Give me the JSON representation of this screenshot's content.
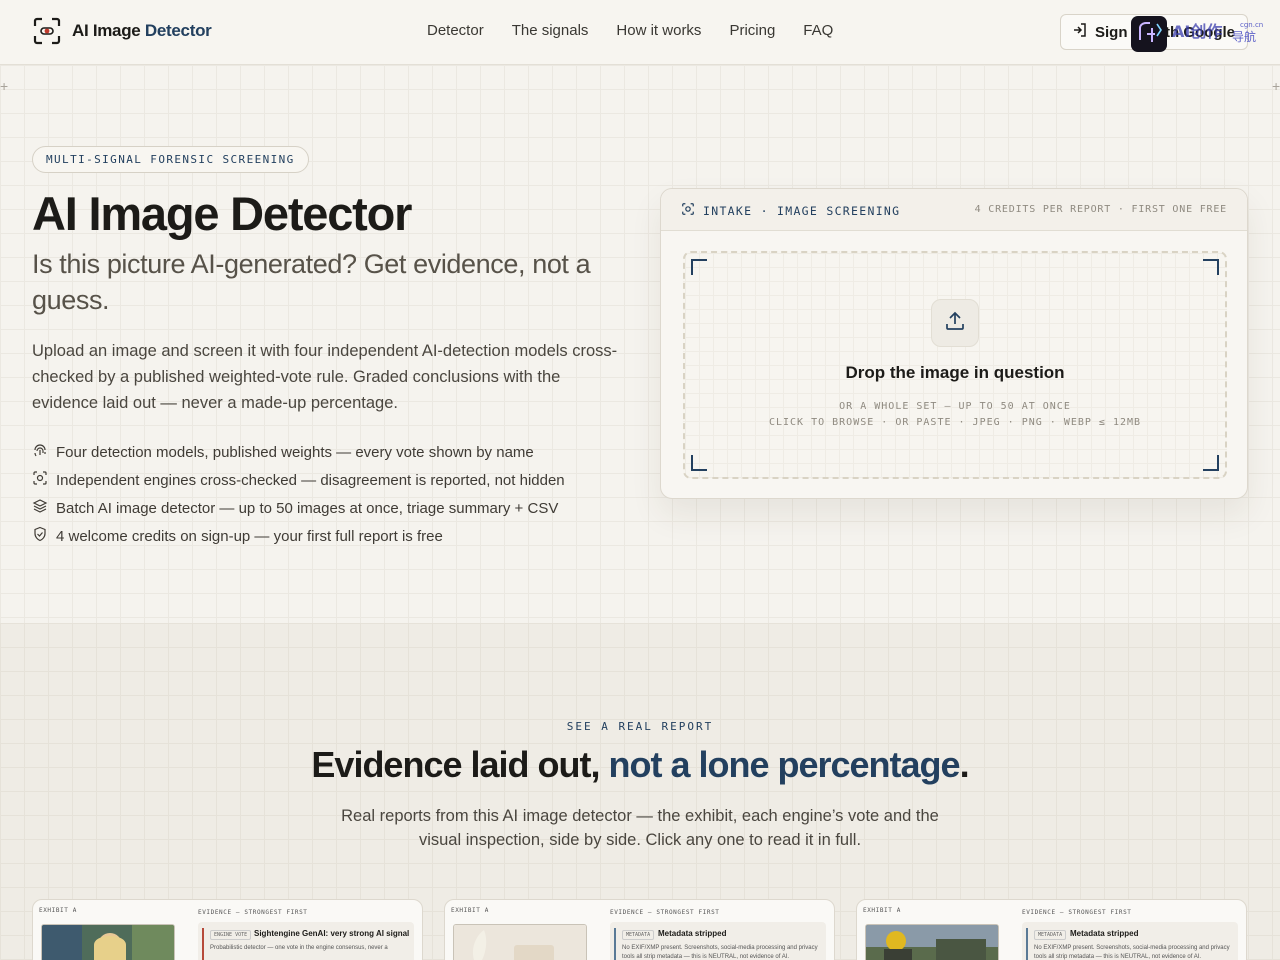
{
  "header": {
    "brand_prefix": "AI Image",
    "brand_accent": "Detector",
    "nav": [
      "Detector",
      "The signals",
      "How it works",
      "Pricing",
      "FAQ"
    ],
    "signin_label": "Sign in with Google"
  },
  "hero": {
    "pill": "MULTI-SIGNAL FORENSIC SCREENING",
    "title": "AI Image Detector",
    "subtitle": "Is this picture AI-generated? Get evidence, not a guess.",
    "lead": "Upload an image and screen it with four independent AI-detection models cross-checked by a published weighted-vote rule. Graded conclusions with the evidence laid out — never a made-up percentage.",
    "features": [
      {
        "icon": "fingerprint-icon",
        "text": "Four detection models, published weights — every vote shown by name"
      },
      {
        "icon": "scan-icon",
        "text": "Independent engines cross-checked — disagreement is reported, not hidden"
      },
      {
        "icon": "layers-icon",
        "text": "Batch AI image detector — up to 50 images at once, triage summary + CSV"
      },
      {
        "icon": "shield-check-icon",
        "text": "4 welcome credits on sign-up — your first full report is free"
      }
    ]
  },
  "intake": {
    "title": "INTAKE · IMAGE SCREENING",
    "meta": "4 CREDITS PER REPORT · FIRST ONE FREE",
    "drop_title": "Drop the image in question",
    "drop_sub_1": "OR A WHOLE SET — UP TO 50 AT ONCE",
    "drop_sub_2": "CLICK TO BROWSE · OR PASTE · JPEG · PNG · WEBP ≤ 12MB"
  },
  "reports_section": {
    "kicker": "SEE A REAL REPORT",
    "title_main": "Evidence laid out, ",
    "title_accent": "not a lone percentage",
    "title_end": ".",
    "subtitle": "Real reports from this AI image detector — the exhibit, each engine’s vote and the visual inspection, side by side. Click any one to read it in full.",
    "cards": [
      {
        "exhibit": "EXHIBIT A",
        "evidence_label": "EVIDENCE — STRONGEST FIRST",
        "tag": "ENGINE VOTE",
        "title": "Sightengine GenAI: very strong AI signal",
        "text": "Probabilistic detector — one vote in the engine consensus, never a"
      },
      {
        "exhibit": "EXHIBIT A",
        "evidence_label": "EVIDENCE — STRONGEST FIRST",
        "tag": "METADATA",
        "title": "Metadata stripped",
        "text": "No EXIF/XMP present. Screenshots, social-media processing and privacy tools all strip metadata — this is NEUTRAL, not evidence of AI."
      },
      {
        "exhibit": "EXHIBIT A",
        "evidence_label": "EVIDENCE — STRONGEST FIRST",
        "tag": "METADATA",
        "title": "Metadata stripped",
        "text": "No EXIF/XMP present. Screenshots, social-media processing and privacy tools all strip metadata — this is NEUTRAL, not evidence of AI."
      }
    ]
  },
  "colors": {
    "accent": "#23405f",
    "background": "#f5f3ee",
    "text": "#1c1b18"
  }
}
